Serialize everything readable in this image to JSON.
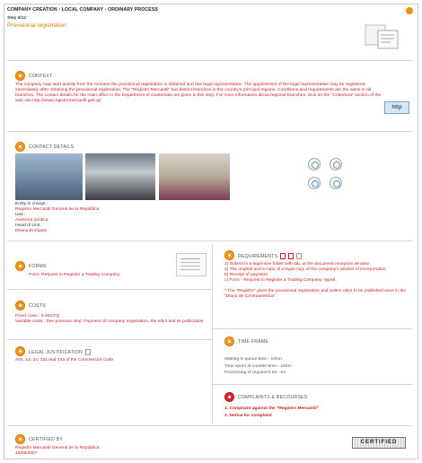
{
  "header": {
    "breadcrumb": "COMPANY CREATION › LOCAL COMPANY - ORDINARY PROCESS",
    "step": "Step 6/12",
    "title": "Provisional registration",
    "image_icon": "form-screenshot-icon"
  },
  "context": {
    "title": "CONTEXT",
    "text": "The company may start activity from the moment the provisional registration is obtained and has legal representative. The appointment of the legal representative may be registered immediately after obtaining the provisional registration. The \"Registro Mercantil\" has district branches in the country's principal regions. Conditions and requirements are the same in all branches. The contact details for the main office in the Department of Guatemala are given in this step. For more information about regional branches, click on the \"Cobertura\" section of the web site http://www.registromercantil.gob.gt/.",
    "link_icon_label": "http"
  },
  "contact": {
    "title": "CONTACT DETAILS",
    "entity_label": "Entity in charge :",
    "entity": "Registro Mercantil General de la República",
    "unit_label": "Unit :",
    "unit": "Asesoría jurídica",
    "head_label": "Head of Unit :",
    "head": "Deana Enríquez"
  },
  "forms": {
    "title": "FORMS",
    "text": "Form: Request to Register a Trading Company"
  },
  "costs": {
    "title": "COSTS",
    "fixed": "Fixed costs : 0.00GTQ",
    "variable": "Variable costs : See previous step: Payment of company registration, the edict and its publication"
  },
  "legal": {
    "title": "LEGAL JUSTIFICATION",
    "text": "Arts. 14, 24, 331 and 343 of the Commercial Code."
  },
  "requirements": {
    "title": "REQUIREMENTS",
    "items": [
      "1) Submit in a legal-size folder with tab, at the document reception window:",
      "a) The original and a copy of a legal copy of the company's articles of incorporation.",
      "b) Receipt of payment.",
      "c) Form - Request to Register a Trading Company -typed."
    ],
    "note": "* The \"Registro\" gives the provisional registration and orders edict to be published once in the \"Diario de Centroamérica\"."
  },
  "timeframe": {
    "title": "TIME FRAME",
    "lines": [
      "Waiting in queue:5mn - 10mn",
      "Time spent at counter:5mn - 10mn",
      "Processing of request:0.04 - 04"
    ]
  },
  "complaints": {
    "title": "COMPLAINTS & RECOURSES",
    "items": [
      "1. Complaint against the \"Registro Mercantil\"",
      "2. Notice for complaint"
    ]
  },
  "certified": {
    "title": "CERTIFIED BY",
    "by": "Registro Mercantil General de la República",
    "date": "19/09/2007",
    "stamp": "CERTIFIED"
  },
  "colors": {
    "accent": "#e07800",
    "text_red": "#c8201e",
    "icon_orange": "#f39a1e"
  }
}
